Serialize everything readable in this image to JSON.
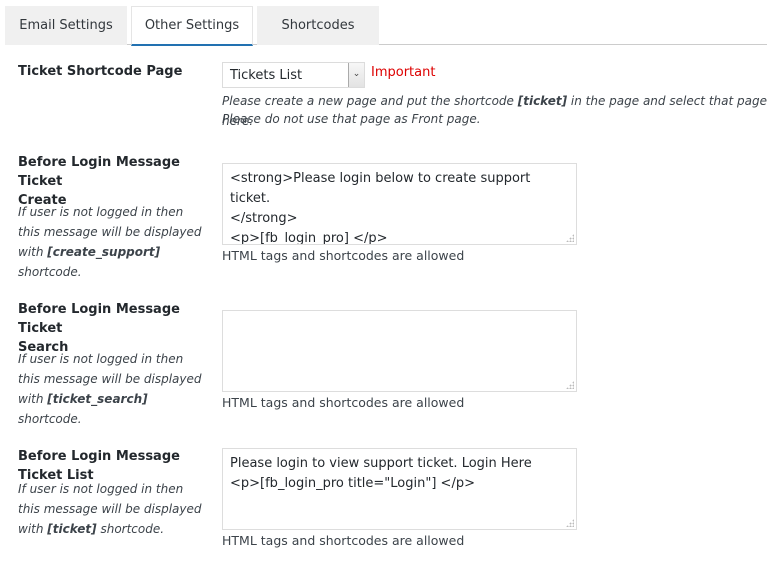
{
  "tabs": [
    {
      "label": "Email Settings",
      "active": false
    },
    {
      "label": "Other Settings",
      "active": true
    },
    {
      "label": "Shortcodes",
      "active": false
    }
  ],
  "ticket_shortcode_page": {
    "label": "Ticket Shortcode Page",
    "select_value": "Tickets List",
    "important_label": "Important",
    "desc_line1_pre": "Please create a new page and put the shortcode ",
    "desc_line1_code": "[ticket]",
    "desc_line1_post": " in the page and select that page here.",
    "desc_line2": "Please do not use that page as Front page."
  },
  "fields": [
    {
      "label_line1": "Before Login Message Ticket",
      "label_line2": "Create",
      "hint_pre": "If user is not logged in then this message will be displayed with ",
      "hint_code": "[create_support]",
      "hint_post": " shortcode.",
      "value": "<strong>Please login below to create support ticket.\n</strong>\n<p>[fb_login_pro] </p>",
      "help": "HTML tags and shortcodes are allowed"
    },
    {
      "label_line1": "Before Login Message Ticket",
      "label_line2": "Search",
      "hint_pre": "If user is not logged in then this message will be displayed with ",
      "hint_code": "[ticket_search]",
      "hint_post": " shortcode.",
      "value": "",
      "help": "HTML tags and shortcodes are allowed"
    },
    {
      "label_line1": "Before Login Message Ticket List",
      "label_line2": "",
      "hint_pre": "If user is not logged in then this message will be displayed with ",
      "hint_code": "[ticket]",
      "hint_post": " shortcode.",
      "value": "Please login to view support ticket. Login Here\n<p>[fb_login_pro title=\"Login\"] </p>",
      "help": "HTML tags and shortcodes are allowed"
    }
  ],
  "colors": {
    "important": "#dd0000",
    "active_tab_underline": "#2271b1",
    "inactive_tab_bg": "#f0f0f0"
  }
}
